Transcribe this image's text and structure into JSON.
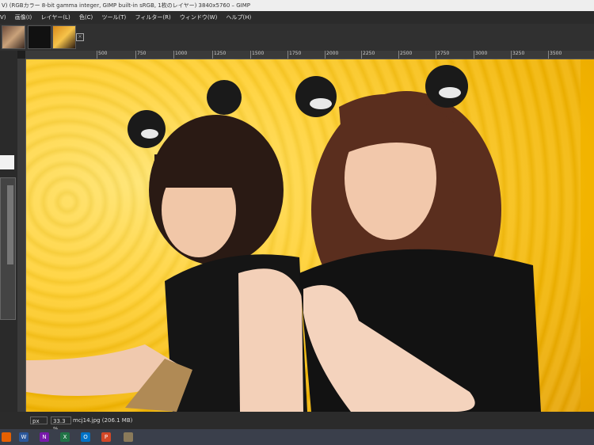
{
  "window": {
    "title": "V) (RGBカラー 8-bit gamma integer, GIMP built-in sRGB, 1枚のレイヤー) 3840x5760 – GIMP"
  },
  "menu": {
    "items": [
      "V)",
      "画像(I)",
      "レイヤー(L)",
      "色(C)",
      "ツール(T)",
      "フィルター(R)",
      "ウィンドウ(W)",
      "ヘルプ(H)"
    ]
  },
  "ruler": {
    "ticks": [
      "500",
      "750",
      "1000",
      "1250",
      "1500",
      "1750",
      "2000",
      "2250",
      "2500",
      "2750",
      "3000",
      "3250",
      "3500"
    ]
  },
  "status": {
    "unit": "px",
    "zoom": "33.3 %",
    "file_info": "mcj14.jpg (206.1 MB)"
  },
  "taskbar": {
    "icons": [
      "firefox-icon",
      "word-icon",
      "onenote-icon",
      "excel-icon",
      "outlook-icon",
      "powerpoint-icon",
      "gimp-icon"
    ]
  },
  "colors": {
    "canvas_bg": "#f5be16",
    "ui_dark": "#2b2b2b"
  }
}
